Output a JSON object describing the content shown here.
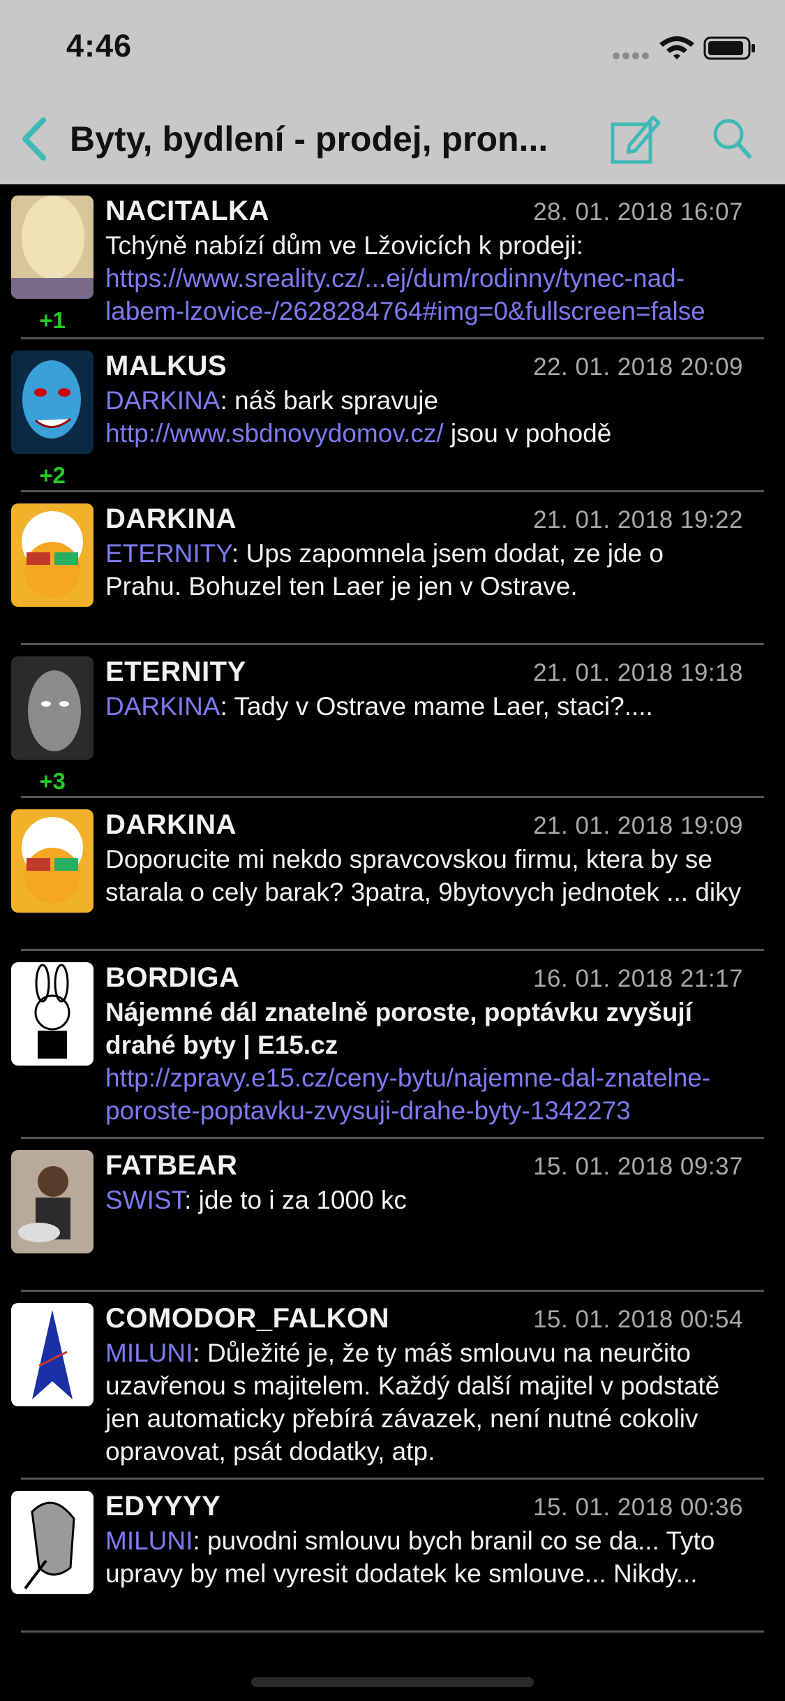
{
  "status": {
    "time": "4:46"
  },
  "nav": {
    "title": "Byty, bydlení - prodej, pron..."
  },
  "colors": {
    "accent": "#3fb9b3",
    "link": "#7e7bf0",
    "score": "#22cc22"
  },
  "posts": [
    {
      "author": "NACITALKA",
      "date": "28. 01. 2018 16:07",
      "score": "+1",
      "text": "Tchýně nabízí dům ve Lžovicích k prodeji:",
      "link": "https://www.sreality.cz/...ej/dum/rodinny/tynec-nad-labem-lzovice-/2628284764#img=0&fullscreen=false"
    },
    {
      "author": "MALKUS",
      "date": "22. 01. 2018 20:09",
      "score": "+2",
      "mention": "DARKINA",
      "text_a": ": náš bark spravuje ",
      "link": "http://www.sbdnovydomov.cz/",
      "text_b": " jsou v pohodě"
    },
    {
      "author": "DARKINA",
      "date": "21. 01. 2018 19:22",
      "score": "",
      "mention": "ETERNITY",
      "text": ": Ups zapomnela jsem dodat, ze jde o Prahu. Bohuzel ten Laer je jen v Ostrave."
    },
    {
      "author": "ETERNITY",
      "date": "21. 01. 2018 19:18",
      "score": "+3",
      "mention": "DARKINA",
      "text": ": Tady v Ostrave mame Laer, staci?...."
    },
    {
      "author": "DARKINA",
      "date": "21. 01. 2018 19:09",
      "score": "",
      "text": "Doporucite mi nekdo spravcovskou firmu, ktera by se starala o cely barak? 3patra, 9bytovych jednotek ... diky"
    },
    {
      "author": "BORDIGA",
      "date": "16. 01. 2018 21:17",
      "score": "",
      "title": "Nájemné dál znatelně poroste, poptávku zvyšují drahé byty | E15.cz",
      "link": "http://zpravy.e15.cz/ceny-bytu/najemne-dal-znatelne-poroste-poptavku-zvysuji-drahe-byty-1342273"
    },
    {
      "author": "FATBEAR",
      "date": "15. 01. 2018 09:37",
      "score": "",
      "mention": "SWIST",
      "text": ": jde to i za 1000 kc"
    },
    {
      "author": "COMODOR_FALKON",
      "date": "15. 01. 2018 00:54",
      "score": "",
      "mention": "MILUNI",
      "text": ": Důležité je, že ty máš smlouvu na neurčito uzavřenou s majitelem. Každý další majitel v podstatě jen automaticky přebírá závazek, není nutné cokoliv opravovat, psát dodatky, atp."
    },
    {
      "author": "EDYYYY",
      "date": "15. 01. 2018 00:36",
      "score": "",
      "mention": "MILUNI",
      "text": ": puvodni smlouvu bych branil co se da... Tyto upravy by mel vyresit dodatek ke smlouve... Nikdy..."
    }
  ]
}
